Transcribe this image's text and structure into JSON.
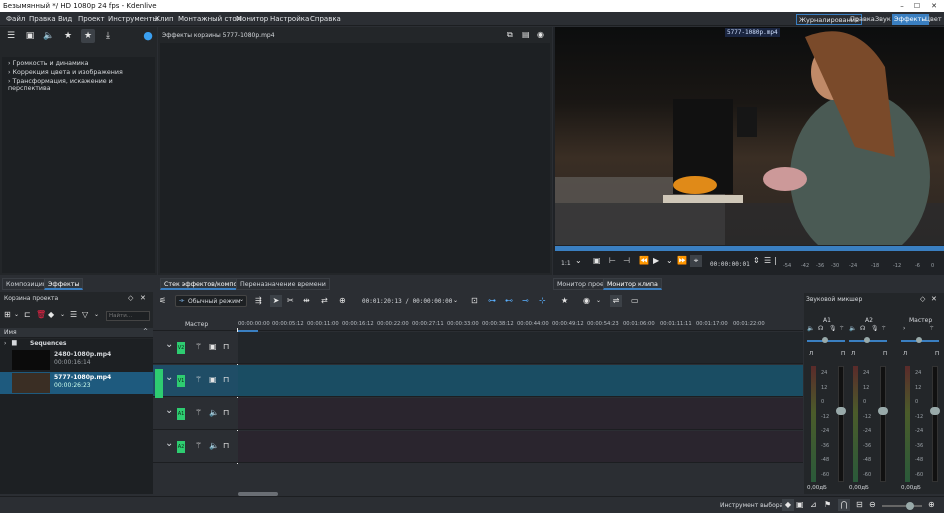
{
  "window": {
    "title": "Безымянный */ HD 1080p 24 fps - Kdenlive"
  },
  "menu": [
    "Файл",
    "Правка",
    "Вид",
    "Проект",
    "Инструменты",
    "Клип",
    "Монтажный стол",
    "Монитор",
    "Настройка",
    "Справка"
  ],
  "workspaces": [
    "Журналирование",
    "Правка",
    "Звук",
    "Эффекты",
    "Цвет"
  ],
  "effects_tree": [
    "Громкость и динамика",
    "Коррекция цвета и изображения",
    "Трансформация, искажение и перспектива"
  ],
  "effects_stack": {
    "title": "Эффекты корзины 5777-1080p.mp4"
  },
  "left_tabs": [
    "Композиции",
    "Эффекты"
  ],
  "middle_tabs": [
    "Стек эффектов/композиций",
    "Переназначение времени"
  ],
  "monitor_tabs": [
    "Монитор проекта",
    "Монитор клипа"
  ],
  "bin": {
    "title": "Корзина проекта",
    "search_placeholder": "Найти...",
    "header": "Имя",
    "items": [
      {
        "name": "Sequences",
        "duration": ""
      },
      {
        "name": "2480-1080p.mp4",
        "duration": "00:00:16:14"
      },
      {
        "name": "5777-1080p.mp4",
        "duration": "00:00:26:23"
      }
    ]
  },
  "monitor": {
    "clip_label": "5777-1080p.mp4",
    "zoom": "1:1",
    "timecode": "00:00:00:01",
    "meter_ticks": [
      "-54",
      "-42",
      "-36",
      "-30",
      "-24",
      "-18",
      "-12",
      "-6",
      "0"
    ]
  },
  "timeline": {
    "mode": "Обычный режим",
    "timecode": "00:01:20:13 / 00:00:00:00",
    "master_label": "Мастер",
    "ruler": [
      "00:00:00:00",
      "00:00:05:12",
      "00:00:11:00",
      "00:00:16:12",
      "00:00:22:00",
      "00:00:27:11",
      "00:00:33:00",
      "00:00:38:12",
      "00:00:44:00",
      "00:00:49:12",
      "00:00:54:23",
      "00:01:06:00",
      "00:01:11:11",
      "00:01:17:00",
      "00:01:22:00"
    ],
    "tracks": [
      {
        "tag": "V2"
      },
      {
        "tag": "V1"
      },
      {
        "tag": "A1"
      },
      {
        "tag": "A2"
      }
    ]
  },
  "mixer": {
    "title": "Звуковой микшер",
    "channels": [
      {
        "name": "A1",
        "value": "0,00дБ"
      },
      {
        "name": "A2",
        "value": "0,00дБ"
      },
      {
        "name": "Мастер",
        "value": "0,00дБ"
      }
    ],
    "lp": [
      "Л",
      "П"
    ],
    "scale": [
      "24",
      "12",
      "0",
      "-12",
      "-24",
      "-36",
      "-48",
      "-60"
    ]
  },
  "status": {
    "tool": "Инструмент выбора"
  }
}
